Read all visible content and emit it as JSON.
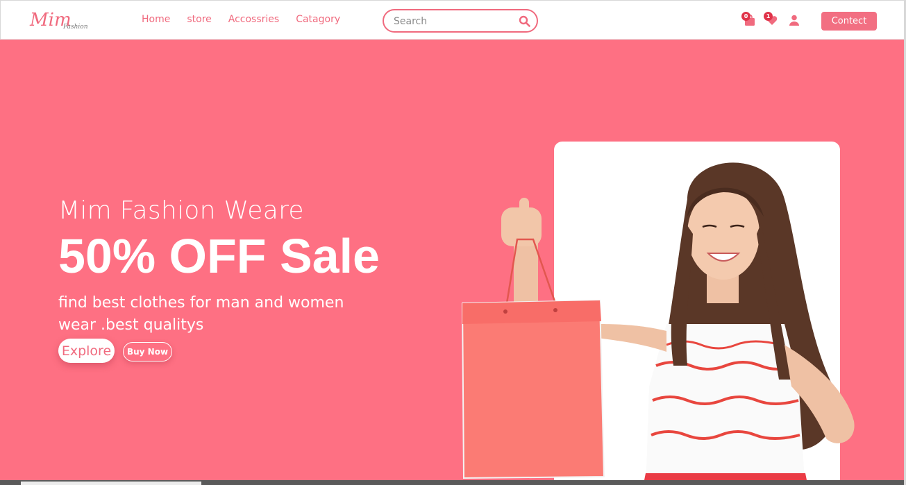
{
  "brand": {
    "logo_text": "Mim",
    "logo_sub": "Fashion"
  },
  "nav": {
    "links": [
      "Home",
      "store",
      "Accossries",
      "Catagory"
    ]
  },
  "search": {
    "placeholder": "Search",
    "icon": "search-icon"
  },
  "header_icons": {
    "cart": {
      "icon": "shopping-bag-icon",
      "count": "0"
    },
    "wishlist": {
      "icon": "heart-icon",
      "count": "1"
    },
    "account": {
      "icon": "user-icon"
    }
  },
  "contact_label": "Contect",
  "hero": {
    "subtitle": "Mim Fashion Weare",
    "title": "50% OFF Sale",
    "description": "find best clothes for man and women wear .best qualitys",
    "explore_label": "Explore",
    "buy_label": "Buy Now",
    "image": "woman-holding-shopping-bag"
  },
  "colors": {
    "accent": "#f06a7e",
    "hero_bg": "#fe7083",
    "badge": "#e03349"
  }
}
